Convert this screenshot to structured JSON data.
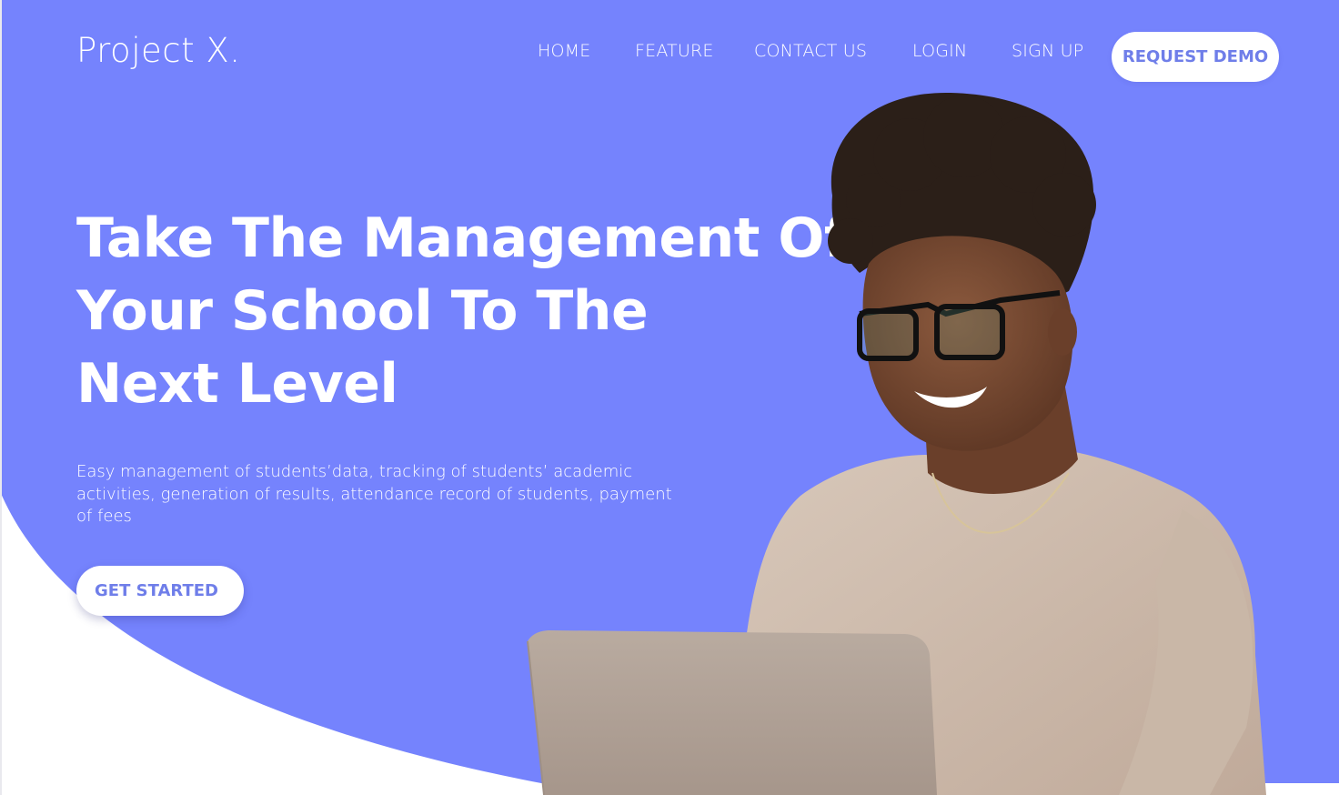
{
  "brand": {
    "logo_text": "Project X."
  },
  "nav": {
    "items": [
      {
        "label": "HOME"
      },
      {
        "label": "FEATURE"
      },
      {
        "label": "CONTACT US"
      },
      {
        "label": "LOGIN"
      },
      {
        "label": "SIGN UP"
      }
    ],
    "cta_label": "REQUEST DEMO"
  },
  "hero": {
    "headline_lines": [
      "Take The Management Of",
      "Your School To The",
      "Next Level"
    ],
    "description": "Easy management of students’data, tracking of students’ academic activities, generation of results, attendance record of students, payment of fees",
    "cta_label": "GET STARTED"
  },
  "colors": {
    "primary": "#7583fd",
    "button_text": "#6f7ee9",
    "page_background": "#ffffff"
  }
}
